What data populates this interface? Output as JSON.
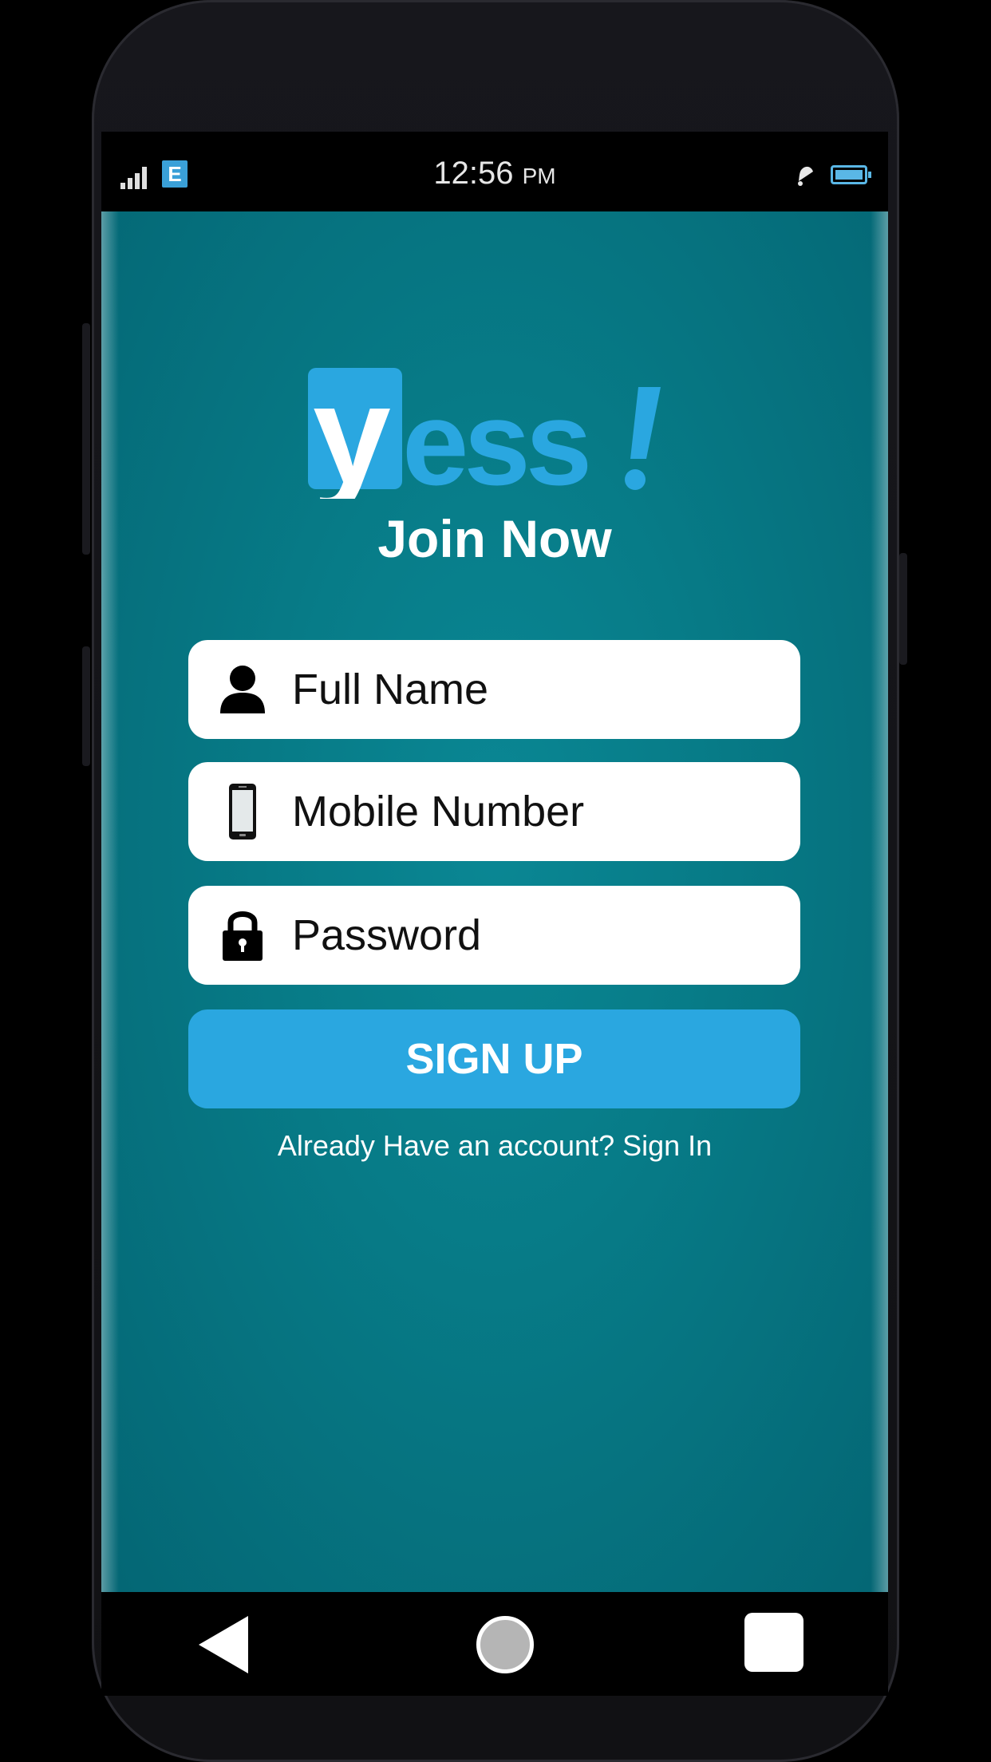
{
  "status_bar": {
    "network_type": "E",
    "time": "12:56",
    "ampm": "PM",
    "icons": [
      "signal-icon",
      "bell-icon",
      "battery-icon"
    ]
  },
  "logo": {
    "text": "yess!",
    "color": "#2aa7e0"
  },
  "header": {
    "title": "Join Now"
  },
  "form": {
    "full_name": {
      "placeholder": "Full Name",
      "icon": "person-icon"
    },
    "mobile": {
      "placeholder": "Mobile Number",
      "icon": "smartphone-icon"
    },
    "password": {
      "placeholder": "Password",
      "icon": "lock-icon"
    }
  },
  "actions": {
    "signup_label": "SIGN UP",
    "signin_text": "Already Have an account? Sign In"
  },
  "navbar": {
    "icons": [
      "back-icon",
      "home-icon",
      "recent-apps-icon"
    ]
  },
  "colors": {
    "background": "#077b87",
    "accent": "#2aa7e0",
    "field_bg": "#ffffff"
  }
}
